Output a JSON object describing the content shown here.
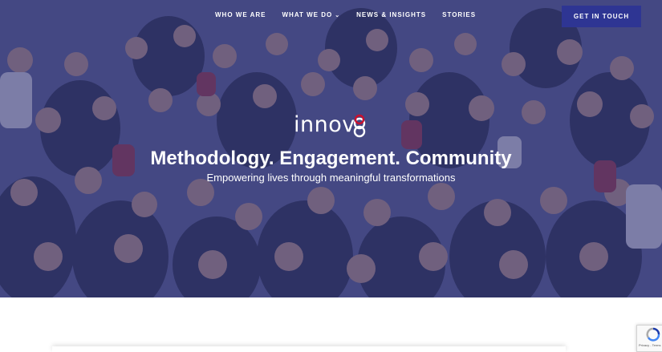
{
  "nav": {
    "links": [
      {
        "label": "WHO WE ARE"
      },
      {
        "label": "WHAT WE DO",
        "chevron": "chevron-down-icon"
      },
      {
        "label": "NEWS & INSIGHTS"
      },
      {
        "label": "STORIES"
      }
    ],
    "cta_label": "GET IN TOUCH"
  },
  "hero": {
    "logo_text": "innov",
    "headline": "Methodology. Engagement. Community",
    "subheadline": "Empowering lives through meaningful transformations"
  },
  "recaptcha": {
    "label": "Privacy - Terms"
  },
  "colors": {
    "brand_navy": "#2e3593",
    "logo_accent": "#c8102e",
    "overlay": "#303478"
  }
}
